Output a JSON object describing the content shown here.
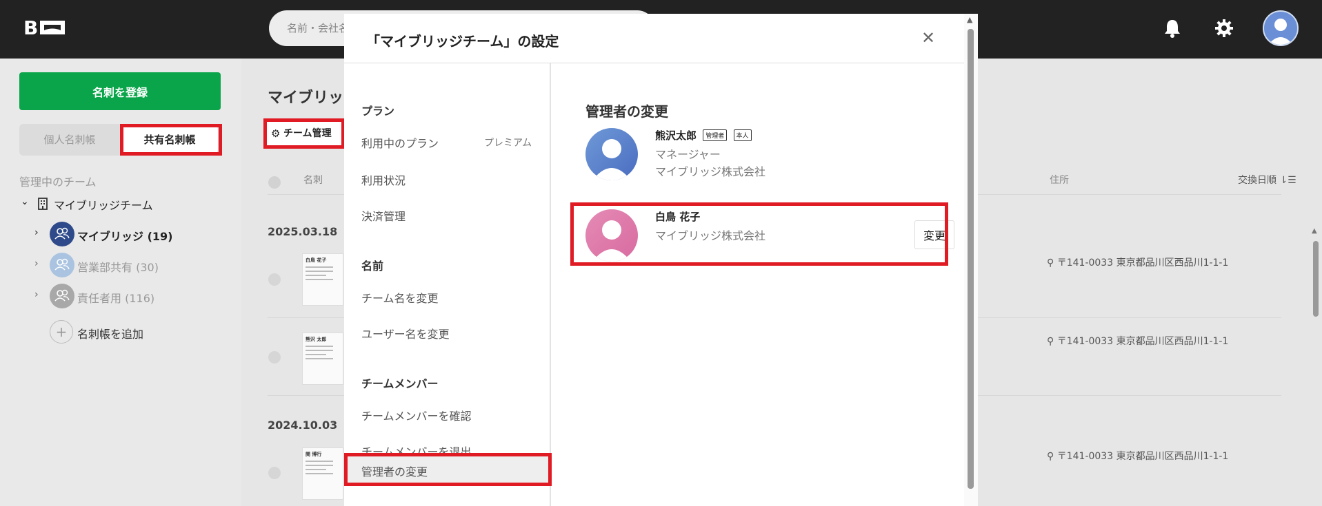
{
  "topbar": {
    "logo_text": "B",
    "search_placeholder": "名前・会社名"
  },
  "sidebar": {
    "register_label": "名刺を登録",
    "tab_personal": "個人名刺帳",
    "tab_shared": "共有名刺帳",
    "caption": "管理中のチーム",
    "team_name": "マイブリッジチーム",
    "items": [
      {
        "label": "マイブリッジ (19)",
        "color": "#2f4a8a"
      },
      {
        "label": "営業部共有 (30)",
        "color": "#a9c3e0"
      },
      {
        "label": "責任者用 (116)",
        "color": "#a8a8a8"
      }
    ],
    "add_label": "名刺帳を追加"
  },
  "main": {
    "title": "マイブリッ",
    "team_manage": "チーム管理",
    "col_name": "名刺",
    "col_address": "住所",
    "col_date": "交換日順",
    "date_group_1": "2025.03.18",
    "date_group_2": "2024.10.03",
    "rows": [
      {
        "card_name": "白鳥 花子",
        "address": "〒141-0033 東京都品川区西品川1-1-1"
      },
      {
        "card_name": "熊沢 太郎",
        "address": "〒141-0033 東京都品川区西品川1-1-1"
      },
      {
        "card_name": "関 博行",
        "address": "〒141-0033 東京都品川区西品川1-1-1"
      }
    ]
  },
  "modal": {
    "title": "「マイブリッジチーム」の設定",
    "close_symbol": "✕",
    "menu": {
      "section_plan": "プラン",
      "plan_in_use": "利用中のプラン",
      "plan_badge": "プレミアム",
      "usage": "利用状況",
      "billing": "決済管理",
      "section_name": "名前",
      "rename_team": "チーム名を変更",
      "rename_user": "ユーザー名を変更",
      "section_members": "チームメンバー",
      "view_members": "チームメンバーを確認",
      "leave_team": "チームメンバーを退出",
      "change_admin": "管理者の変更"
    },
    "content": {
      "heading": "管理者の変更",
      "admin": {
        "name": "熊沢太郎",
        "tag_admin": "管理者",
        "tag_self": "本人",
        "role": "マネージャー",
        "company": "マイブリッジ株式会社"
      },
      "member": {
        "name": "白鳥 花子",
        "company": "マイブリッジ株式会社",
        "change_label": "変更"
      }
    }
  },
  "colors": {
    "accent_green": "#0aa54a",
    "highlight_red": "#e01b24",
    "topbar": "#222222"
  }
}
